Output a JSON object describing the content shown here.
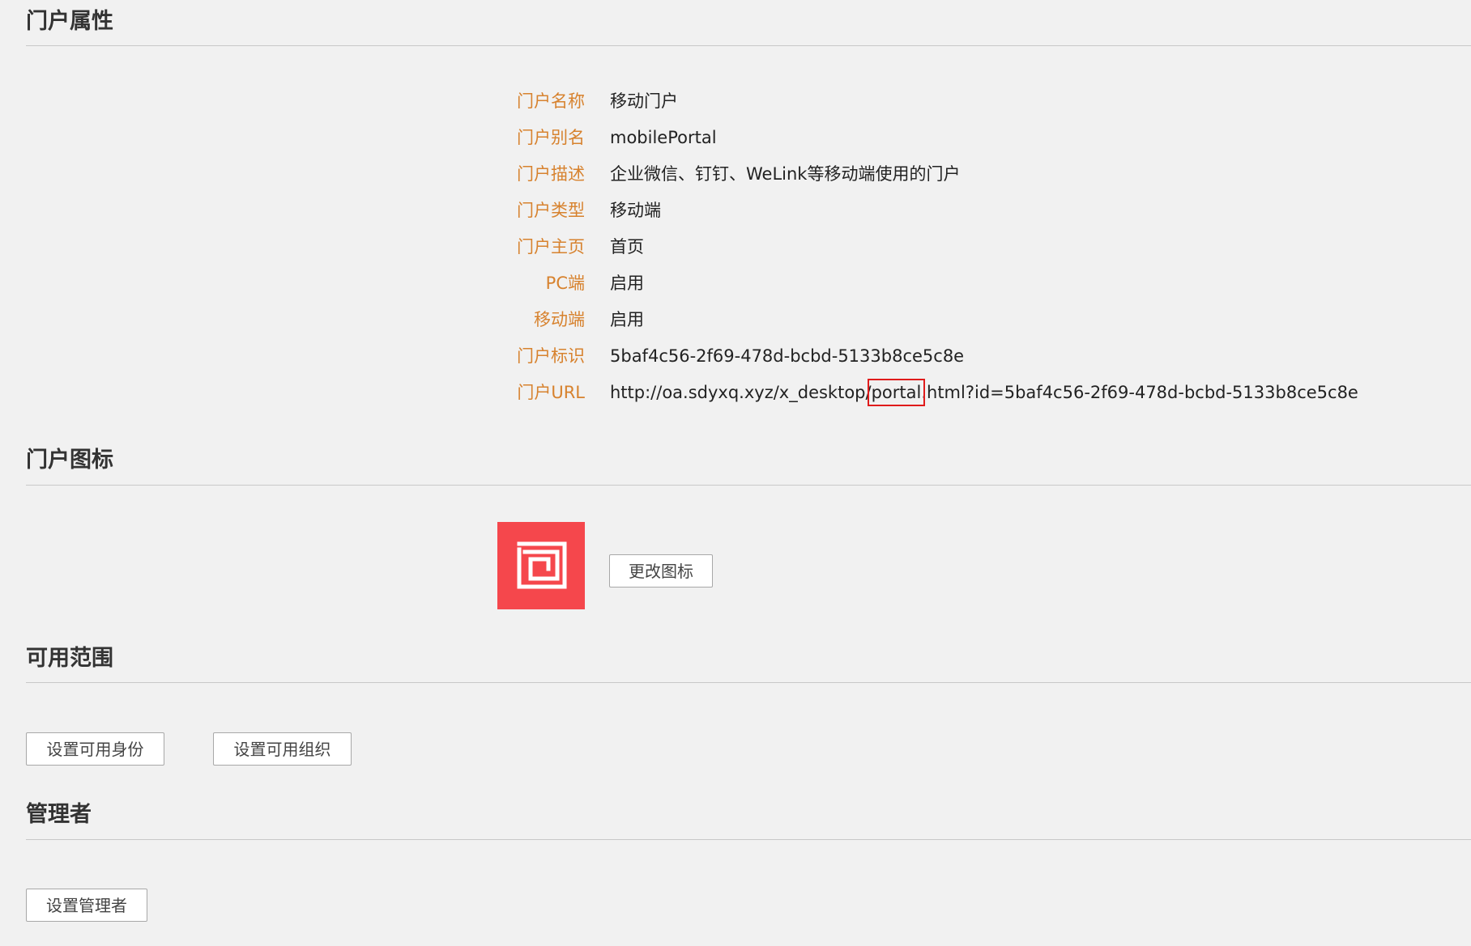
{
  "sections": {
    "properties": {
      "title": "门户属性"
    },
    "icon": {
      "title": "门户图标",
      "change_button": "更改图标"
    },
    "scope": {
      "title": "可用范围",
      "set_identity_button": "设置可用身份",
      "set_org_button": "设置可用组织"
    },
    "admins": {
      "title": "管理者",
      "set_admin_button": "设置管理者"
    }
  },
  "properties": [
    {
      "label": "门户名称",
      "value": "移动门户"
    },
    {
      "label": "门户别名",
      "value": "mobilePortal"
    },
    {
      "label": "门户描述",
      "value": "企业微信、钉钉、WeLink等移动端使用的门户"
    },
    {
      "label": "门户类型",
      "value": "移动端"
    },
    {
      "label": "门户主页",
      "value": "首页"
    },
    {
      "label": "PC端",
      "value": "启用"
    },
    {
      "label": "移动端",
      "value": "启用"
    },
    {
      "label": "门户标识",
      "value": "5baf4c56-2f69-478d-bcbd-5133b8ce5c8e"
    },
    {
      "label": "门户URL",
      "value_prefix": "http://oa.sdyxq.xyz/x_desktop/",
      "value_highlight": "portal",
      "value_suffix": ".html?id=5baf4c56-2f69-478d-bcbd-5133b8ce5c8e"
    }
  ],
  "colors": {
    "label": "#d7822e",
    "icon_background": "#f5474c",
    "highlight_box": "#e01b1b"
  },
  "icon": {
    "name": "portal-logo-icon"
  }
}
